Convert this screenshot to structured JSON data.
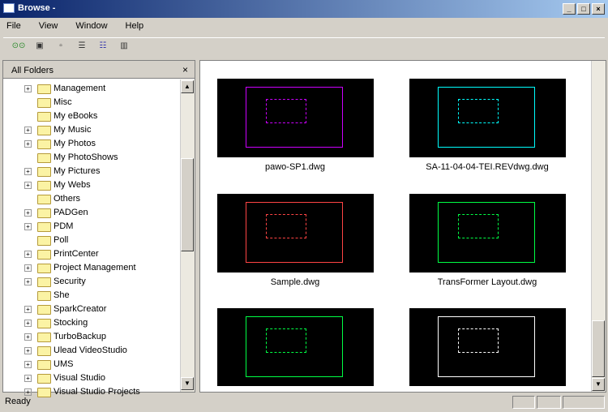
{
  "window": {
    "title": "Browse -",
    "min": "_",
    "max": "□",
    "close": "×"
  },
  "menu": [
    "File",
    "View",
    "Window",
    "Help"
  ],
  "toolbar": [
    "go-icon",
    "large-icons-icon",
    "small-icons-icon",
    "list-icon",
    "details-icon",
    "columns-icon"
  ],
  "folders": {
    "header": "All Folders",
    "close": "×",
    "items": [
      {
        "label": "Management",
        "exp": true
      },
      {
        "label": "Misc",
        "exp": false
      },
      {
        "label": "My eBooks",
        "exp": false
      },
      {
        "label": "My Music",
        "exp": true
      },
      {
        "label": "My Photos",
        "exp": true
      },
      {
        "label": "My PhotoShows",
        "exp": false
      },
      {
        "label": "My Pictures",
        "exp": true
      },
      {
        "label": "My Webs",
        "exp": true
      },
      {
        "label": "Others",
        "exp": false
      },
      {
        "label": "PADGen",
        "exp": true
      },
      {
        "label": "PDM",
        "exp": true
      },
      {
        "label": "Poll",
        "exp": false
      },
      {
        "label": "PrintCenter",
        "exp": true
      },
      {
        "label": "Project Management",
        "exp": true
      },
      {
        "label": "Security",
        "exp": true
      },
      {
        "label": "She",
        "exp": false
      },
      {
        "label": "SparkCreator",
        "exp": true
      },
      {
        "label": "Stocking",
        "exp": true
      },
      {
        "label": "TurboBackup",
        "exp": true
      },
      {
        "label": "Ulead VideoStudio",
        "exp": true
      },
      {
        "label": "UMS",
        "exp": true
      },
      {
        "label": "Visual Studio",
        "exp": true
      },
      {
        "label": "Visual Studio Projects",
        "exp": true
      }
    ]
  },
  "files": [
    "pawo-SP1.dwg",
    "SA-11-04-04-TEI.REVdwg.dwg",
    "Sample.dwg",
    "TransFormer Layout.dwg",
    "",
    ""
  ],
  "status": "Ready"
}
